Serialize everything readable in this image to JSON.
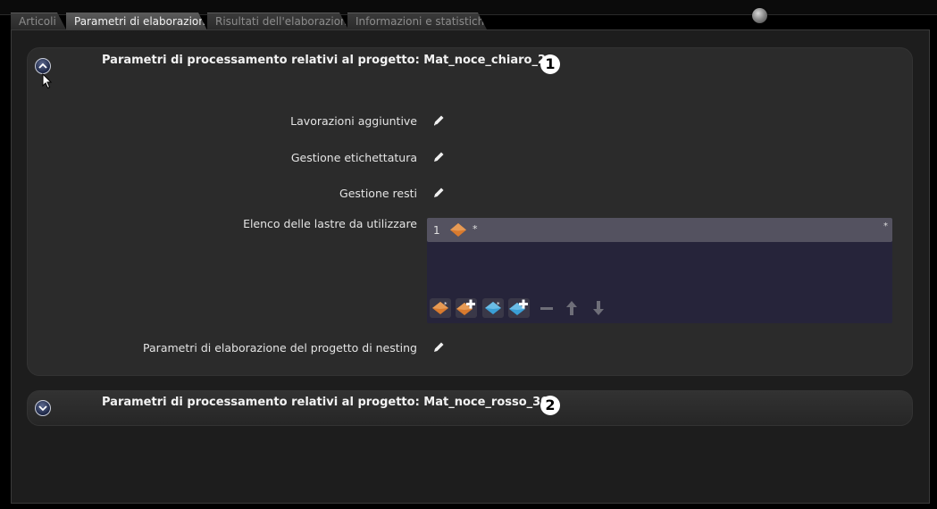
{
  "tabs": [
    {
      "label": "Articoli",
      "active": false
    },
    {
      "label": "Parametri di elaborazione",
      "active": true
    },
    {
      "label": "Risultati dell'elaborazione",
      "active": false
    },
    {
      "label": "Informazioni e statistiche",
      "active": false
    }
  ],
  "panel1": {
    "title": "Parametri di processamento relativi al progetto: Mat_noce_chiaro_20",
    "badge": "1",
    "expanded": true,
    "rows": {
      "lavorazioni": "Lavorazioni aggiuntive",
      "etichettatura": "Gestione etichettatura",
      "resti": "Gestione resti",
      "lastre": "Elenco delle lastre da utilizzare",
      "nesting": "Parametri di elaborazione del progetto di nesting"
    },
    "slab_list": {
      "items": [
        {
          "index": "1",
          "name": "*",
          "end_marker": "*"
        }
      ]
    }
  },
  "panel2": {
    "title": "Parametri di processamento relativi al progetto: Mat_noce_rosso_30",
    "badge": "2",
    "expanded": false
  },
  "colors": {
    "slab_orange": "#d87a2e",
    "slab_blue": "#3a9fd6",
    "panel_bg": "#2b2b2b",
    "list_bg": "#26243a"
  },
  "icons": [
    "status-dot-icon",
    "collapse-icon",
    "expand-icon",
    "edit-icon",
    "slab-icon",
    "add-slab-icon",
    "blue-slab-icon",
    "add-blue-slab-icon",
    "remove-icon",
    "move-up-icon",
    "move-down-icon",
    "cursor-icon"
  ]
}
